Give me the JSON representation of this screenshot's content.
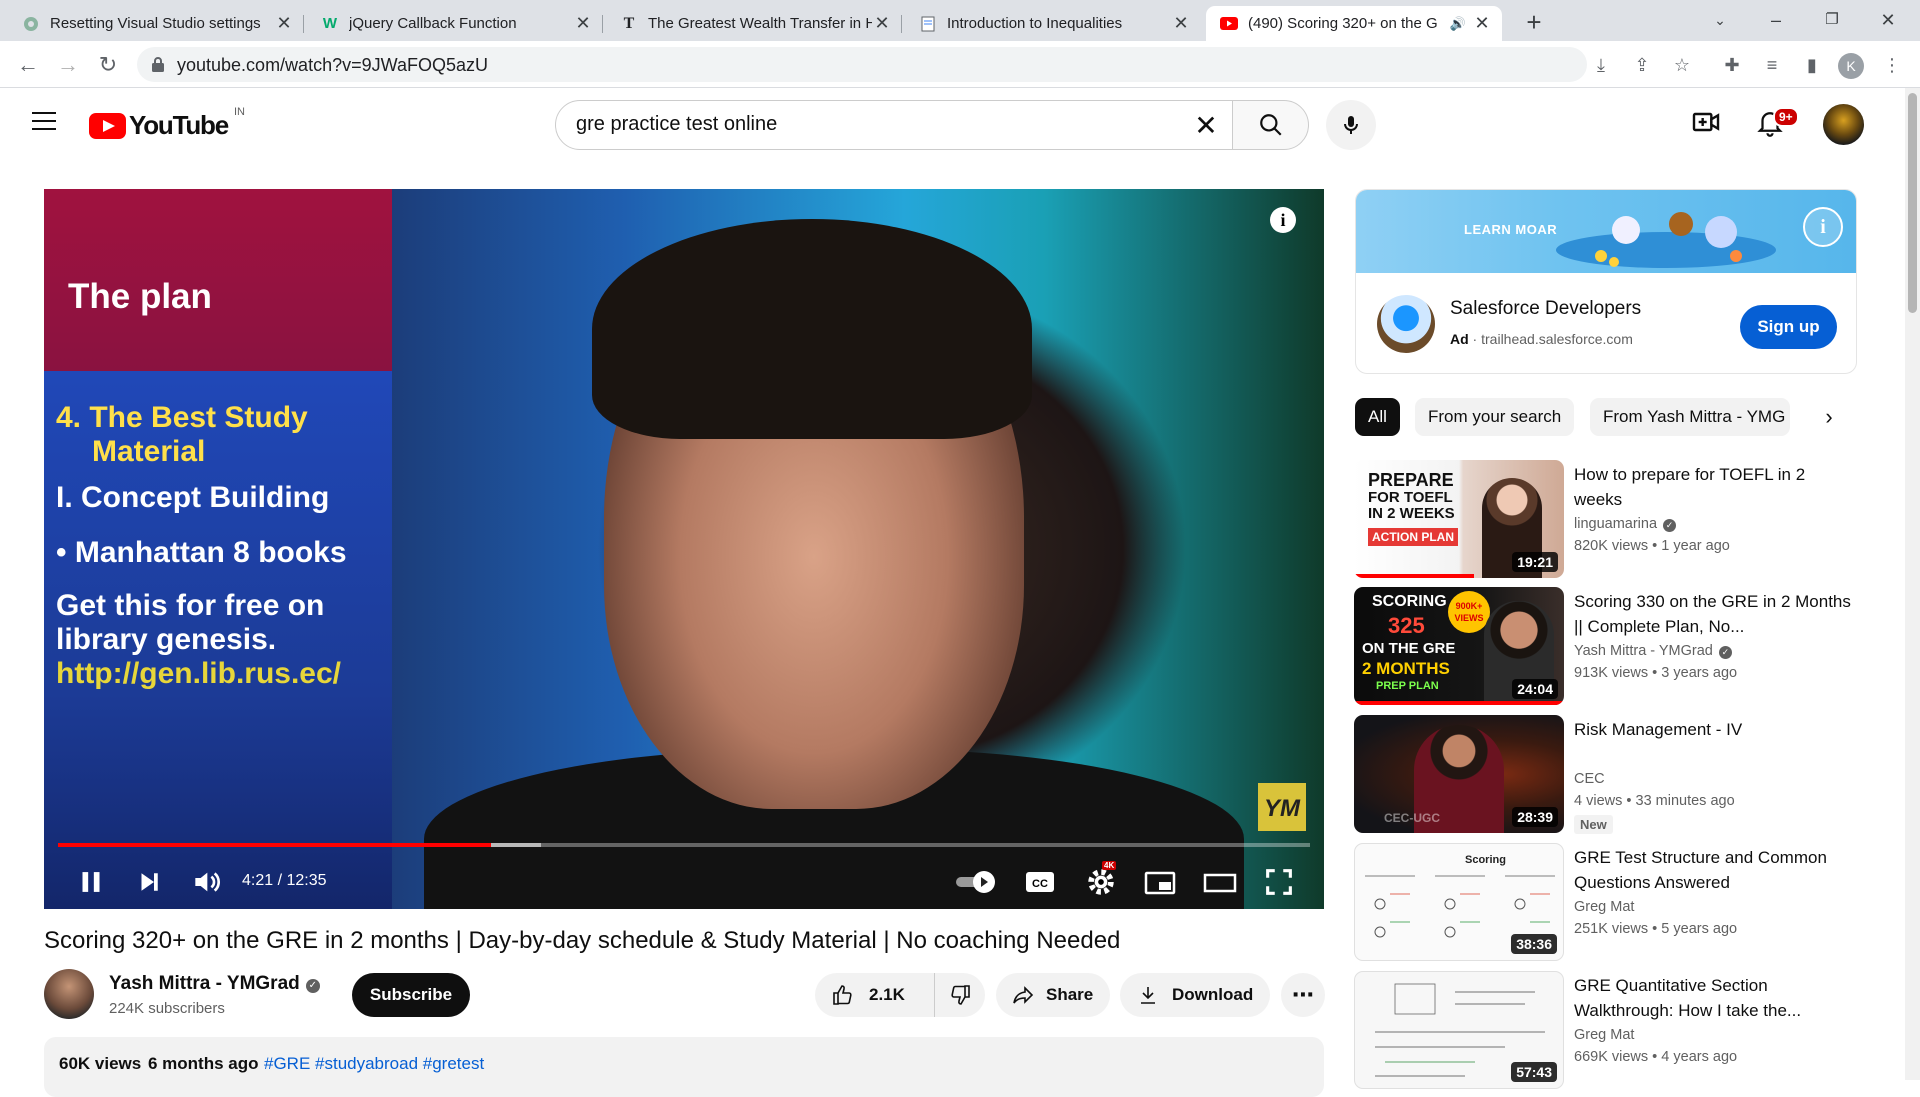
{
  "browser": {
    "tabs": [
      {
        "title": "Resetting Visual Studio settings",
        "icon": "settings-favicon"
      },
      {
        "title": "jQuery Callback Function",
        "icon": "w3schools-favicon"
      },
      {
        "title": "The Greatest Wealth Transfer in H",
        "icon": "nytimes-favicon"
      },
      {
        "title": "Introduction to Inequalities",
        "icon": "document-favicon"
      },
      {
        "title": "(490) Scoring 320+ on the G",
        "icon": "youtube-favicon",
        "active": true
      }
    ],
    "url": "youtube.com/watch?v=9JWaFOQ5azU",
    "profile_initial": "K"
  },
  "youtube": {
    "logo_text": "YouTube",
    "country_code": "IN",
    "search_value": "gre practice test online",
    "notifications_badge": "9+"
  },
  "player": {
    "panel_title": "The plan",
    "panel_lines": [
      "4. The Best Study",
      "Material",
      "I. Concept Building",
      "• Manhattan 8 books",
      "Get this for free on",
      "library genesis.",
      "http://gen.lib.rus.ec/"
    ],
    "watermark": "YM",
    "time_display": "4:21 / 12:35",
    "played_fraction": 0.3457,
    "buffered_fraction": 0.3857,
    "quality_badge": "4K"
  },
  "video": {
    "title": "Scoring 320+ on the GRE in 2 months | Day-by-day schedule & Study Material | No coaching Needed",
    "channel_name": "Yash Mittra - YMGrad",
    "subscribers": "224K subscribers",
    "subscribe_label": "Subscribe",
    "likes": "2.1K",
    "share_label": "Share",
    "download_label": "Download",
    "views": "60K views",
    "age": "6 months ago",
    "hashtags": "#GRE #studyabroad #gretest"
  },
  "ad": {
    "banner_text": "LEARN MOAR",
    "advertiser": "Salesforce Developers",
    "ad_label": "Ad",
    "domain": "trailhead.salesforce.com",
    "cta": "Sign up"
  },
  "chips": [
    "All",
    "From your search",
    "From Yash Mittra - YMG"
  ],
  "recommended": [
    {
      "title": "How to prepare for TOEFL in 2 weeks",
      "channel": "linguamarina",
      "verified": true,
      "views": "820K views",
      "age": "1 year ago",
      "duration": "19:21",
      "thumb_text": [
        "PREPARE",
        "FOR TOEFL",
        "IN 2 WEEKS",
        "ACTION PLAN"
      ]
    },
    {
      "title": "Scoring 330 on the GRE in 2 Months || Complete Plan, No...",
      "channel": "Yash Mittra - YMGrad",
      "verified": true,
      "views": "913K views",
      "age": "3 years ago",
      "duration": "24:04",
      "thumb_text": [
        "SCORING",
        "325",
        "ON THE GRE",
        "2 MONTHS",
        "PREP PLAN",
        "900K+ VIEWS"
      ]
    },
    {
      "title": "Risk Management - IV",
      "channel": "CEC",
      "verified": false,
      "views": "4 views",
      "age": "33 minutes ago",
      "duration": "28:39",
      "badge": "New",
      "thumb_text": [
        "CEC-UGC"
      ]
    },
    {
      "title": "GRE Test Structure and Common Questions Answered",
      "channel": "Greg Mat",
      "verified": false,
      "views": "251K views",
      "age": "5 years ago",
      "duration": "38:36",
      "thumb_text": [
        "Scoring"
      ]
    },
    {
      "title": "GRE Quantitative Section Walkthrough: How I take the...",
      "channel": "Greg Mat",
      "verified": false,
      "views": "669K views",
      "age": "4 years ago",
      "duration": "57:43",
      "thumb_text": []
    }
  ]
}
